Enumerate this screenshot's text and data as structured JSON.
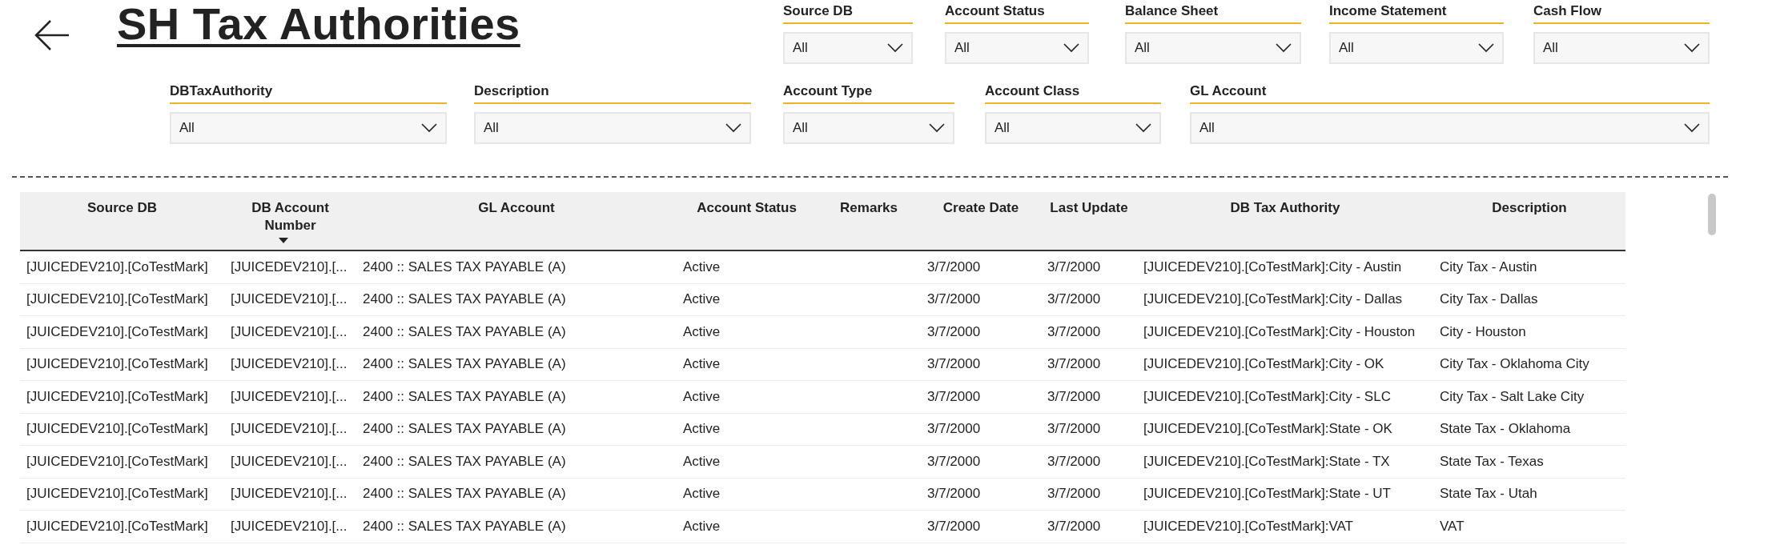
{
  "title": "SH Tax Authorities",
  "filter_rows": [
    [
      {
        "label": "Source DB",
        "value": "All"
      },
      {
        "label": "Account Status",
        "value": "All"
      },
      {
        "label": "Balance Sheet",
        "value": "All"
      },
      {
        "label": "Income Statement",
        "value": "All"
      },
      {
        "label": "Cash Flow",
        "value": "All"
      }
    ],
    [
      {
        "label": "DBTaxAuthority",
        "value": "All"
      },
      {
        "label": "Description",
        "value": "All"
      },
      {
        "label": "Account Type",
        "value": "All"
      },
      {
        "label": "Account Class",
        "value": "All"
      },
      {
        "label": "GL Account",
        "value": "All"
      }
    ]
  ],
  "table": {
    "columns": [
      {
        "label": "Source DB",
        "sorted": false
      },
      {
        "label": "DB Account Number",
        "sorted": true
      },
      {
        "label": "GL Account",
        "sorted": false
      },
      {
        "label": "Account Status",
        "sorted": false
      },
      {
        "label": "Remarks",
        "sorted": false
      },
      {
        "label": "Create Date",
        "sorted": false
      },
      {
        "label": "Last Update",
        "sorted": false
      },
      {
        "label": "DB Tax Authority",
        "sorted": false
      },
      {
        "label": "Description",
        "sorted": false
      }
    ],
    "rows": [
      {
        "source_db": "[JUICEDEV210].[CoTestMark]",
        "db_account_number": "[JUICEDEV210].[...",
        "gl_account": "2400 :: SALES TAX PAYABLE (A)",
        "account_status": "Active",
        "create_date": "3/7/2000",
        "last_update": "3/7/2000",
        "db_tax_authority": "[JUICEDEV210].[CoTestMark]:City - Austin",
        "description": "City Tax - Austin"
      },
      {
        "source_db": "[JUICEDEV210].[CoTestMark]",
        "db_account_number": "[JUICEDEV210].[...",
        "gl_account": "2400 :: SALES TAX PAYABLE (A)",
        "account_status": "Active",
        "create_date": "3/7/2000",
        "last_update": "3/7/2000",
        "db_tax_authority": "[JUICEDEV210].[CoTestMark]:City - Dallas",
        "description": "City Tax - Dallas"
      },
      {
        "source_db": "[JUICEDEV210].[CoTestMark]",
        "db_account_number": "[JUICEDEV210].[...",
        "gl_account": "2400 :: SALES TAX PAYABLE (A)",
        "account_status": "Active",
        "create_date": "3/7/2000",
        "last_update": "3/7/2000",
        "db_tax_authority": "[JUICEDEV210].[CoTestMark]:City - Houston",
        "description": "City - Houston"
      },
      {
        "source_db": "[JUICEDEV210].[CoTestMark]",
        "db_account_number": "[JUICEDEV210].[...",
        "gl_account": "2400 :: SALES TAX PAYABLE (A)",
        "account_status": "Active",
        "create_date": "3/7/2000",
        "last_update": "3/7/2000",
        "db_tax_authority": "[JUICEDEV210].[CoTestMark]:City - OK",
        "description": "City Tax - Oklahoma City"
      },
      {
        "source_db": "[JUICEDEV210].[CoTestMark]",
        "db_account_number": "[JUICEDEV210].[...",
        "gl_account": "2400 :: SALES TAX PAYABLE (A)",
        "account_status": "Active",
        "create_date": "3/7/2000",
        "last_update": "3/7/2000",
        "db_tax_authority": "[JUICEDEV210].[CoTestMark]:City - SLC",
        "description": "City Tax - Salt Lake City"
      },
      {
        "source_db": "[JUICEDEV210].[CoTestMark]",
        "db_account_number": "[JUICEDEV210].[...",
        "gl_account": "2400 :: SALES TAX PAYABLE (A)",
        "account_status": "Active",
        "create_date": "3/7/2000",
        "last_update": "3/7/2000",
        "db_tax_authority": "[JUICEDEV210].[CoTestMark]:State - OK",
        "description": "State Tax - Oklahoma"
      },
      {
        "source_db": "[JUICEDEV210].[CoTestMark]",
        "db_account_number": "[JUICEDEV210].[...",
        "gl_account": "2400 :: SALES TAX PAYABLE (A)",
        "account_status": "Active",
        "create_date": "3/7/2000",
        "last_update": "3/7/2000",
        "db_tax_authority": "[JUICEDEV210].[CoTestMark]:State - TX",
        "description": "State Tax - Texas"
      },
      {
        "source_db": "[JUICEDEV210].[CoTestMark]",
        "db_account_number": "[JUICEDEV210].[...",
        "gl_account": "2400 :: SALES TAX PAYABLE (A)",
        "account_status": "Active",
        "create_date": "3/7/2000",
        "last_update": "3/7/2000",
        "db_tax_authority": "[JUICEDEV210].[CoTestMark]:State - UT",
        "description": "State Tax - Utah"
      },
      {
        "source_db": "[JUICEDEV210].[CoTestMark]",
        "db_account_number": "[JUICEDEV210].[...",
        "gl_account": "2400 :: SALES TAX PAYABLE (A)",
        "account_status": "Active",
        "create_date": "3/7/2000",
        "last_update": "3/7/2000",
        "db_tax_authority": "[JUICEDEV210].[CoTestMark]:VAT",
        "description": "VAT"
      }
    ]
  }
}
